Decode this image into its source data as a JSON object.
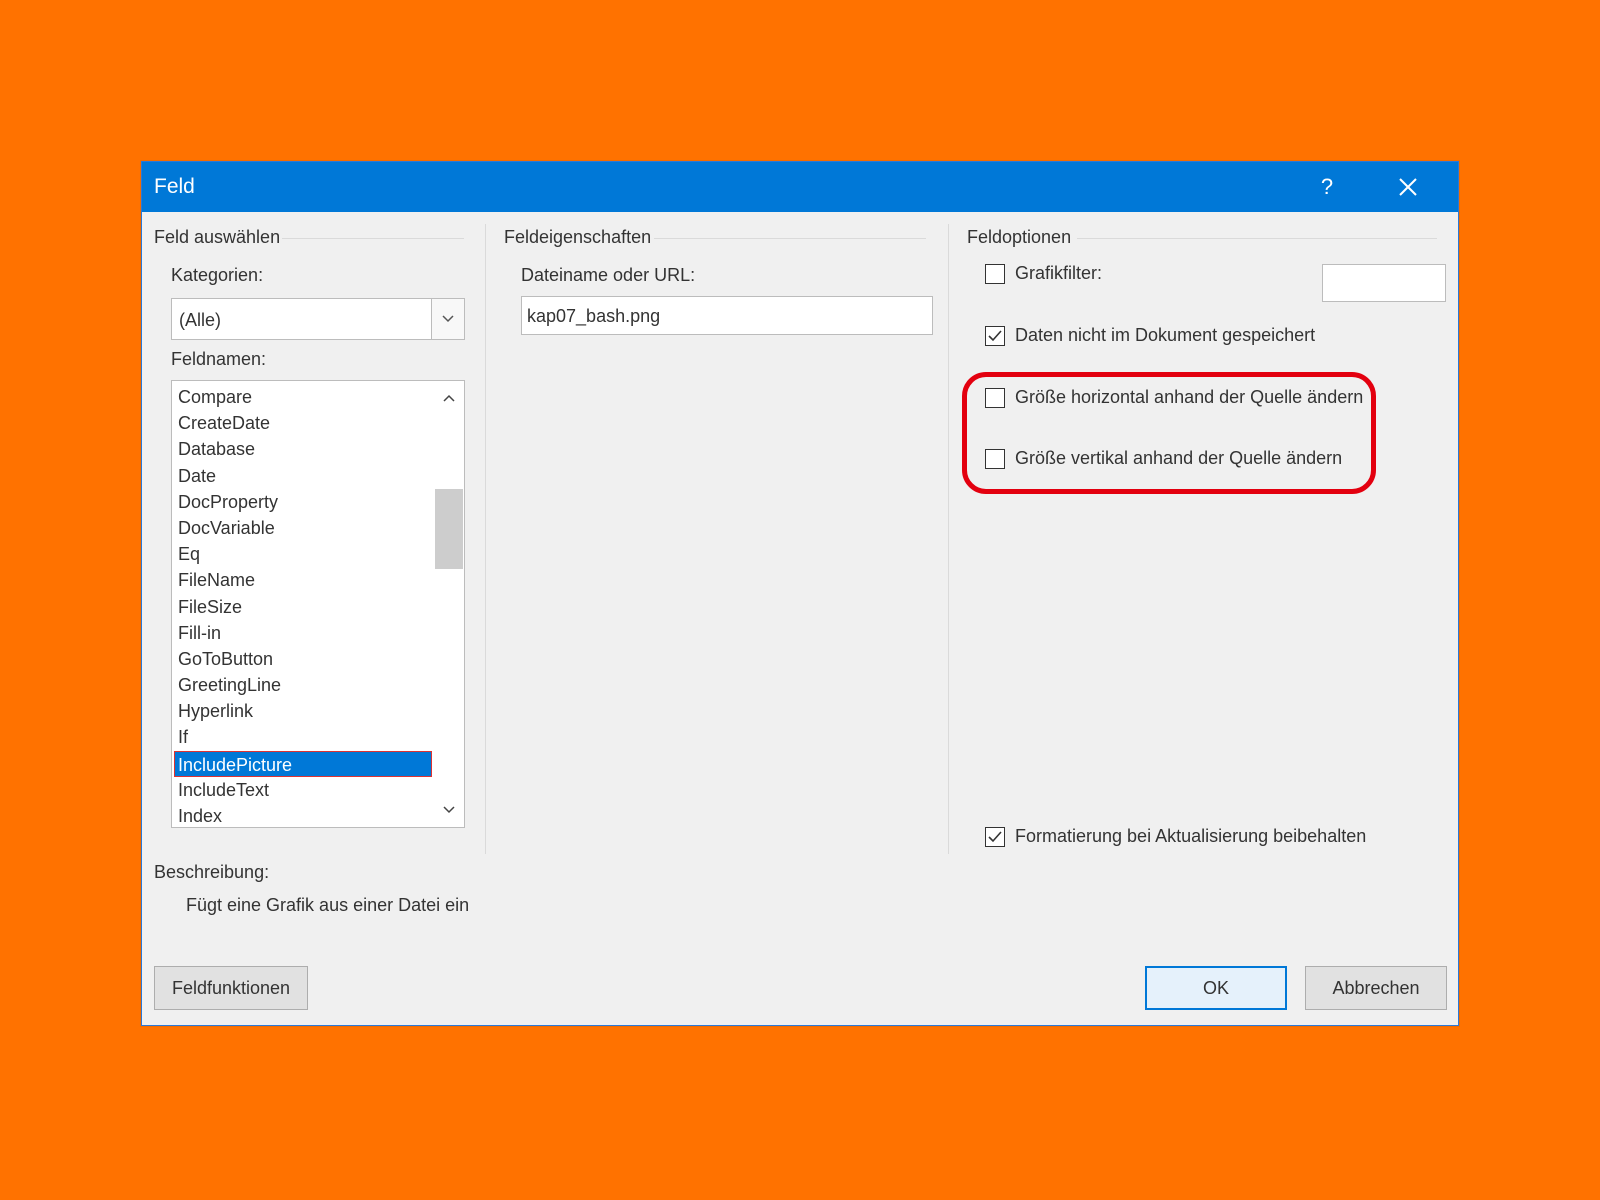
{
  "colors": {
    "background": "#FF7200",
    "titlebar": "#0078D7",
    "selection": "#0078D7",
    "highlight_ring": "#E3000F"
  },
  "dialog": {
    "title": "Feld",
    "help_glyph": "?",
    "close_icon": "close-icon"
  },
  "select_field": {
    "heading": "Feld auswählen",
    "categories_label": "Kategorien:",
    "categories_value": "(Alle)",
    "field_names_label": "Feldnamen:",
    "field_names": [
      "Compare",
      "CreateDate",
      "Database",
      "Date",
      "DocProperty",
      "DocVariable",
      "Eq",
      "FileName",
      "FileSize",
      "Fill-in",
      "GoToButton",
      "GreetingLine",
      "Hyperlink",
      "If",
      "IncludePicture",
      "IncludeText",
      "Index"
    ],
    "selected_field": "IncludePicture"
  },
  "properties": {
    "heading": "Feldeigenschaften",
    "filename_label": "Dateiname oder URL:",
    "filename_value": "kap07_bash.png"
  },
  "options": {
    "heading": "Feldoptionen",
    "graphic_filter": {
      "label": "Grafikfilter:",
      "checked": false,
      "value": ""
    },
    "not_stored": {
      "label": "Daten nicht im Dokument gespeichert",
      "checked": true
    },
    "resize_horizontal": {
      "label": "Größe horizontal anhand der Quelle ändern",
      "checked": false
    },
    "resize_vertical": {
      "label": "Größe vertikal anhand der Quelle ändern",
      "checked": false
    },
    "preserve_formatting": {
      "label": "Formatierung bei Aktualisierung beibehalten",
      "checked": true
    }
  },
  "description": {
    "label": "Beschreibung:",
    "text": "Fügt eine Grafik aus einer Datei ein"
  },
  "buttons": {
    "field_codes": "Feldfunktionen",
    "ok": "OK",
    "cancel": "Abbrechen"
  }
}
